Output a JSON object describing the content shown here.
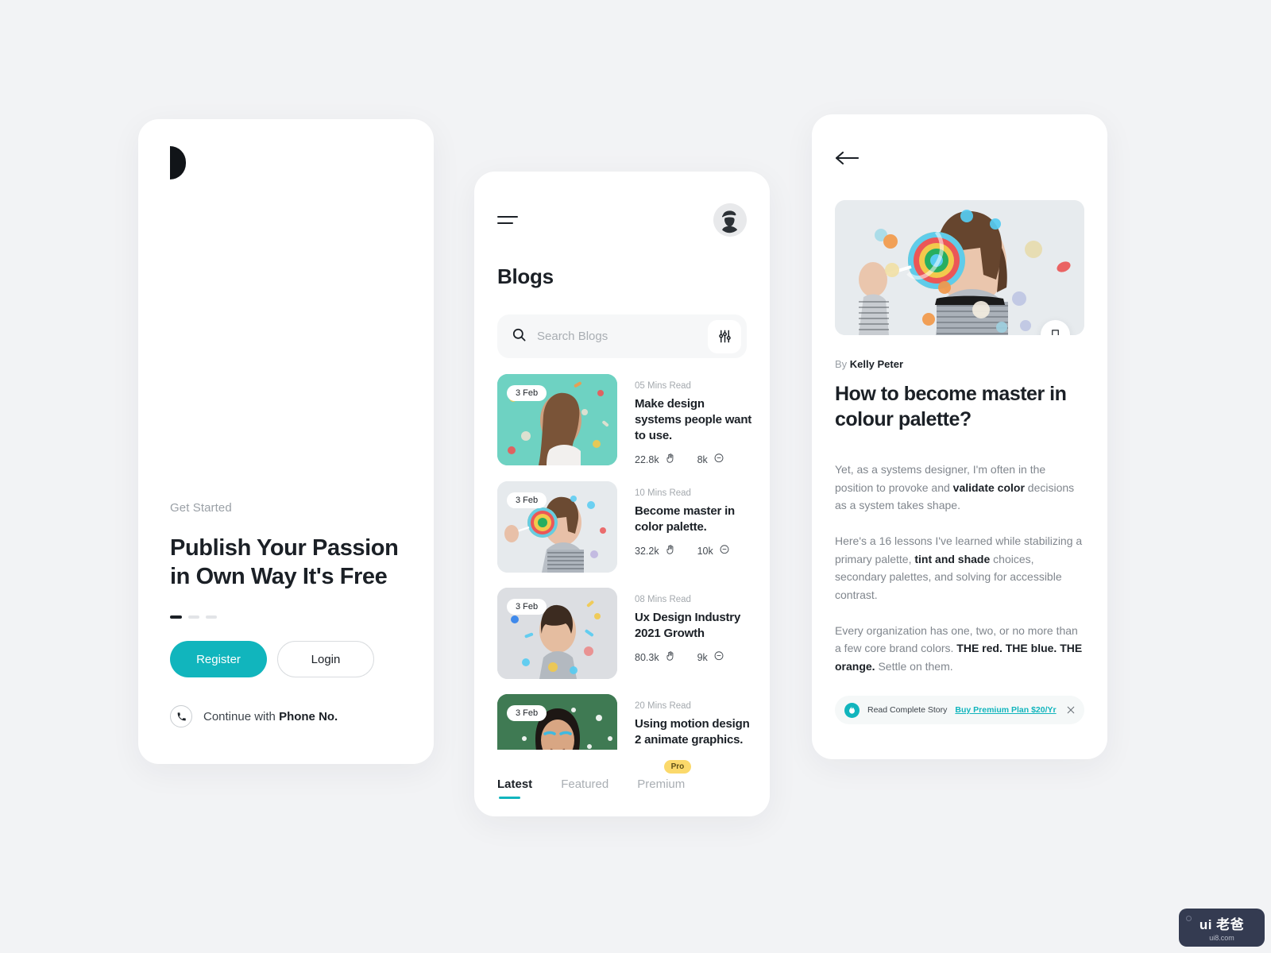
{
  "theme": {
    "background": "#f2f3f5",
    "accent": "#11b5bd",
    "ink": "#1b2026",
    "muted": "#9aa0a6",
    "badge_yellow": "#fbd96b"
  },
  "onboarding": {
    "logo": "logo-d-mark",
    "eyebrow": "Get Started",
    "title": "Publish Your Passion in Own Way It's Free",
    "dots": {
      "total": 3,
      "active_index": 0
    },
    "register_label": "Register",
    "login_label": "Login",
    "phone_prefix": "Continue with ",
    "phone_strong": "Phone No."
  },
  "bloglist": {
    "menu_icon": "hamburger-icon",
    "avatar": "user-avatar",
    "title": "Blogs",
    "search": {
      "placeholder": "Search Blogs",
      "value": "",
      "icon": "search-icon",
      "filter_icon": "sliders-filter-icon"
    },
    "items": [
      {
        "date": "3 Feb",
        "read_time": "05 Mins Read",
        "title": "Make design systems people want to use.",
        "claps": "22.8k",
        "comments": "8k",
        "thumb_color": "#6ed2c2"
      },
      {
        "date": "3 Feb",
        "read_time": "10 Mins Read",
        "title": "Become master in color palette.",
        "claps": "32.2k",
        "comments": "10k",
        "thumb_color": "#dfe3e7"
      },
      {
        "date": "3 Feb",
        "read_time": "08 Mins Read",
        "title": "Ux Design Industry 2021 Growth",
        "claps": "80.3k",
        "comments": "9k",
        "thumb_color": "#d8dade"
      },
      {
        "date": "3 Feb",
        "read_time": "20 Mins Read",
        "title": "Using motion design 2 animate graphics.",
        "claps": "",
        "comments": "",
        "thumb_color": "#3f7a53"
      }
    ],
    "tabs": [
      {
        "label": "Latest",
        "active": true,
        "badge": ""
      },
      {
        "label": "Featured",
        "active": false,
        "badge": ""
      },
      {
        "label": "Premium",
        "active": false,
        "badge": "Pro"
      }
    ]
  },
  "article": {
    "back_icon": "back-arrow-icon",
    "hero_image": "girl-with-lollipop-photo",
    "bookmark_icon": "bookmark-icon",
    "byline_prefix": "By ",
    "author": "Kelly Peter",
    "title": "How to become master in colour palette?",
    "paragraphs": [
      {
        "parts": [
          {
            "text": "Yet, as a systems designer, I'm often in the position to provoke and ",
            "bold": false
          },
          {
            "text": "validate color",
            "bold": true
          },
          {
            "text": " decisions as a system takes shape.",
            "bold": false
          }
        ]
      },
      {
        "parts": [
          {
            "text": "Here's a 16 lessons I've learned while stabilizing a primary palette, ",
            "bold": false
          },
          {
            "text": "tint and shade",
            "bold": true
          },
          {
            "text": " choices, secondary palettes, and solving for accessible contrast.",
            "bold": false
          }
        ]
      },
      {
        "parts": [
          {
            "text": "Every organization has one, two, or no more than a few core brand colors. ",
            "bold": false
          },
          {
            "text": "THE red. THE blue. THE orange.",
            "bold": true
          },
          {
            "text": " Settle on them.",
            "bold": false
          }
        ]
      }
    ],
    "promo": {
      "icon": "flame-icon",
      "text": "Read Complete Story",
      "link": "Buy Premium Plan $20/Yr",
      "close_icon": "close-icon"
    }
  },
  "watermark": {
    "main": "ui 老爸",
    "sub": "ui8.com"
  }
}
